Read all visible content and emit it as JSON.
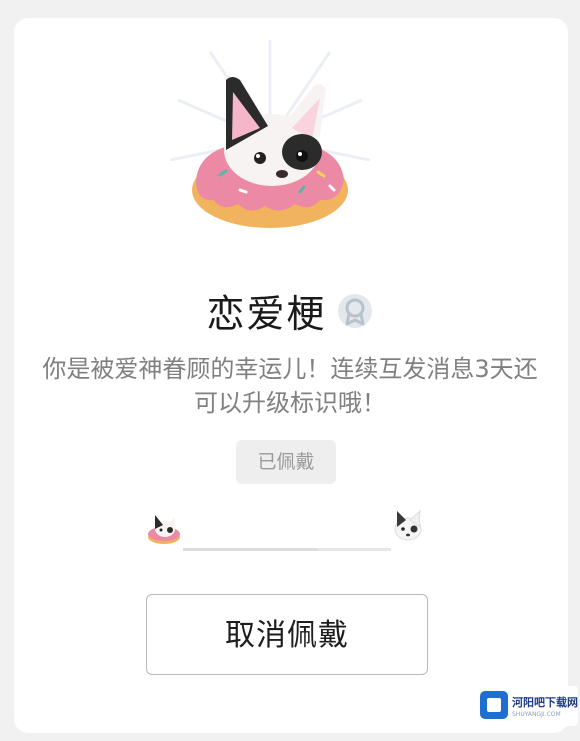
{
  "badge": {
    "title": "恋爱梗",
    "description": "你是被爱神眷顾的幸运儿！连续互发消息3天还可以升级标识哦！",
    "status_label": "已佩戴",
    "level_progress": 0.65
  },
  "actions": {
    "cancel_label": "取消佩戴"
  },
  "watermark": {
    "name": "河阳吧下载网",
    "sub": "SHUYANGJI.COM"
  },
  "icons": {
    "hero": "dog-donut-icon",
    "badge": "award-ribbon-icon",
    "level_start": "dog-donut-small-icon",
    "level_next": "dog-small-icon"
  },
  "colors": {
    "donut_frosting": "#ec8aa6",
    "donut_dough": "#f1b35e",
    "title": "#1a1a1a",
    "description": "#808080"
  }
}
